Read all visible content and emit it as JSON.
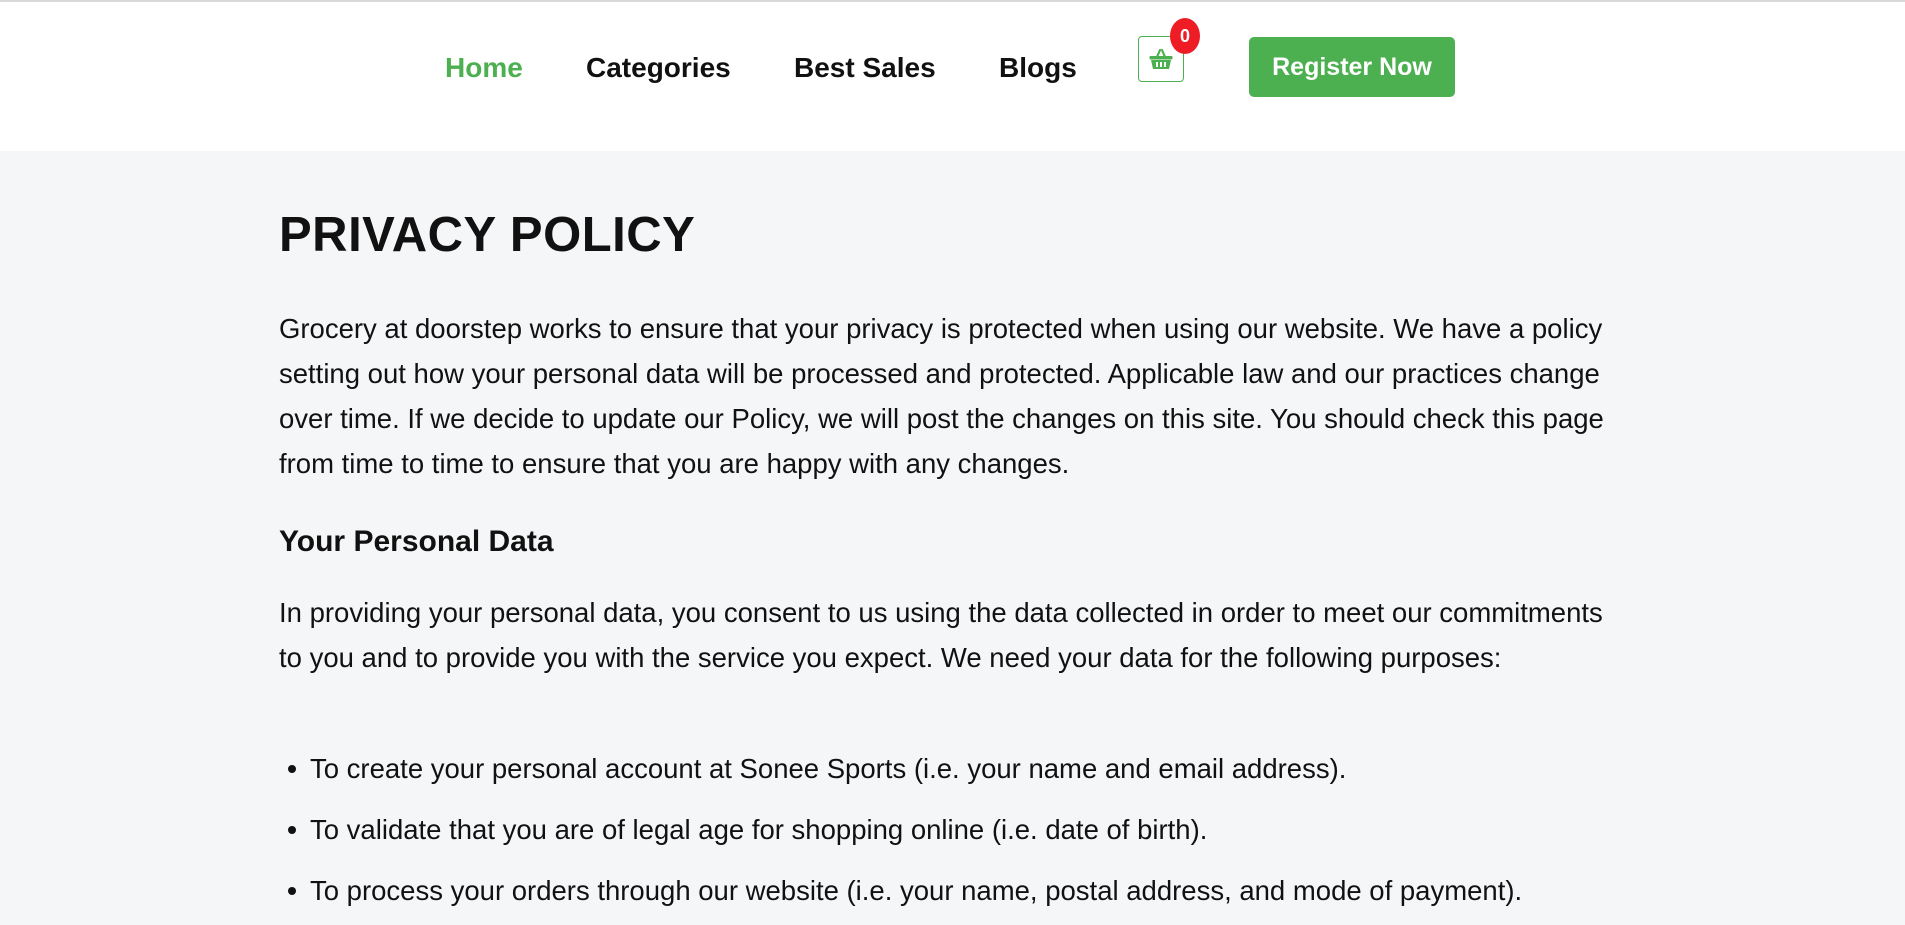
{
  "nav": {
    "items": [
      {
        "label": "Home",
        "active": true
      },
      {
        "label": "Categories",
        "active": false
      },
      {
        "label": "Best Sales",
        "active": false
      },
      {
        "label": "Blogs",
        "active": false
      }
    ],
    "cart_count": "0",
    "register_label": "Register Now"
  },
  "colors": {
    "accent": "#4caf50",
    "badge": "#ee1c25",
    "background": "#f5f6f8"
  },
  "icons": {
    "cart": "basket-icon"
  },
  "content": {
    "title": "PRIVACY POLICY",
    "intro": "Grocery at doorstep works to ensure that your privacy is protected when using our website. We have a policy setting out how your personal data will be processed and protected. Applicable law and our practices change over time. If we decide to update our Policy, we will post the changes on this site. You should check this page from time to time to ensure that you are happy with any changes.",
    "section_heading": "Your Personal Data",
    "section_text": "In providing your personal data, you consent to us using the data collected in order to meet our commitments to you and to provide you with the service you expect. We need your data for the following purposes:",
    "purposes": [
      "To create your personal account at Sonee Sports (i.e. your name and email address).",
      "To validate that you are of legal age for shopping online (i.e. date of birth).",
      "To process your orders through our website (i.e. your name, postal address, and mode of payment)."
    ]
  }
}
